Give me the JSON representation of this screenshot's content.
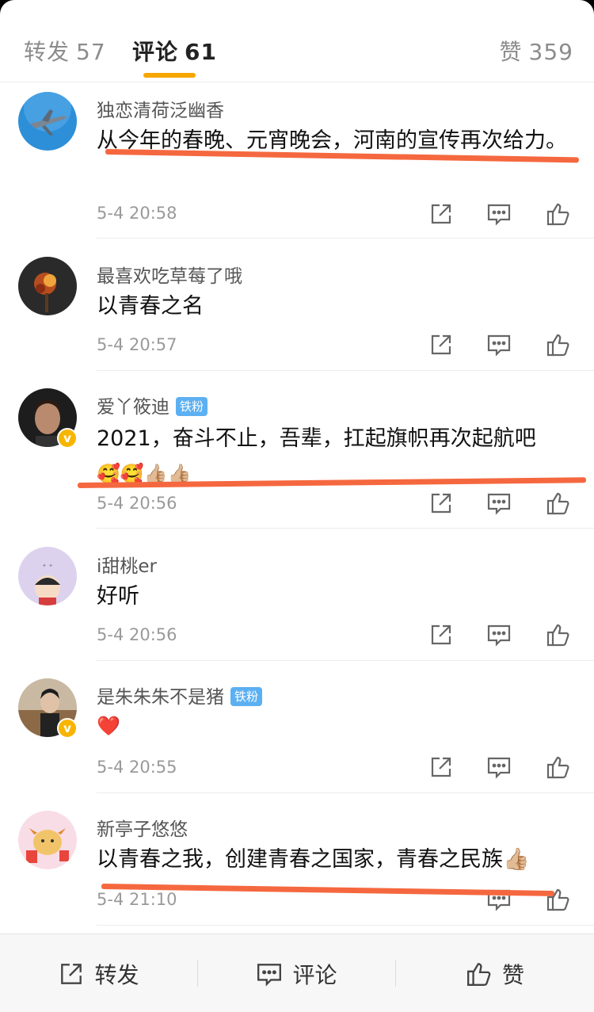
{
  "tabs": {
    "repost": {
      "label": "转发",
      "count": "57"
    },
    "comment": {
      "label": "评论",
      "count": "61"
    },
    "like": {
      "label": "赞",
      "count": "359"
    }
  },
  "comments": [
    {
      "user": "独恋清荷泛幽香",
      "text": "从今年的春晚、元宵晚会，河南的宣传再次给力。",
      "time": "5-4 20:58"
    },
    {
      "user": "最喜欢吃草莓了哦",
      "text": "以青春之名",
      "time": "5-4 20:57"
    },
    {
      "user": "爱丫筱迪",
      "badge": "铁粉",
      "text": "2021，奋斗不止，吾辈，扛起旗帜再次起航吧",
      "emoji": "🥰🥰👍🏼👍🏼",
      "time": "5-4 20:56"
    },
    {
      "user": "i甜桃er",
      "text": "好听",
      "time": "5-4 20:56"
    },
    {
      "user": "是朱朱朱不是猪",
      "badge": "铁粉",
      "text": "❤️",
      "time": "5-4 20:55"
    },
    {
      "user": "新亭子悠悠",
      "text": "以青春之我，创建青春之国家，青春之民族👍🏼",
      "time": "5-4 21:10"
    }
  ],
  "bottom_bar": {
    "repost": "转发",
    "comment": "评论",
    "like": "赞"
  },
  "colors": {
    "accent": "#f7a600",
    "underline": "#f5683f",
    "badge": "#5cb0f2",
    "verified": "#f7b500"
  }
}
